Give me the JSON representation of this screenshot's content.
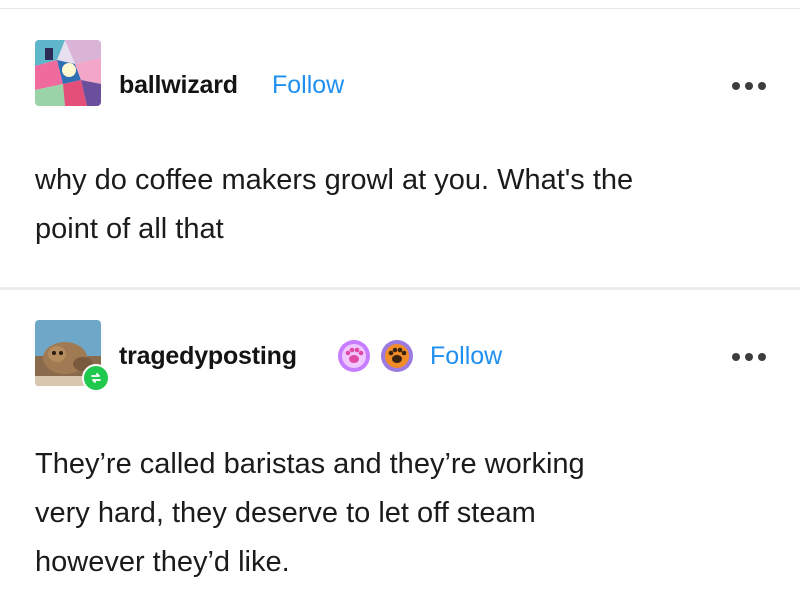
{
  "posts": [
    {
      "username": "ballwizard",
      "follow_label": "Follow",
      "body": "why do coffee makers growl at you. What's the point of all that",
      "body_lines": [
        "why do coffee makers growl at you. What's the",
        "point of all that"
      ]
    },
    {
      "username": "tragedyposting",
      "follow_label": "Follow",
      "badges": [
        "paw-badge-pink",
        "paw-badge-orange"
      ],
      "body_lines": [
        "They’re called baristas and they’re working",
        "very hard, they deserve to let off steam",
        "however they’d like."
      ]
    }
  ],
  "icons": {
    "more": "more-options-icon",
    "reblog": "reblog-icon"
  },
  "colors": {
    "follow": "#1f8ff0",
    "reblog_badge": "#1ec94d",
    "badge_pink": "#c77dff",
    "badge_orange": "#f28c28"
  }
}
